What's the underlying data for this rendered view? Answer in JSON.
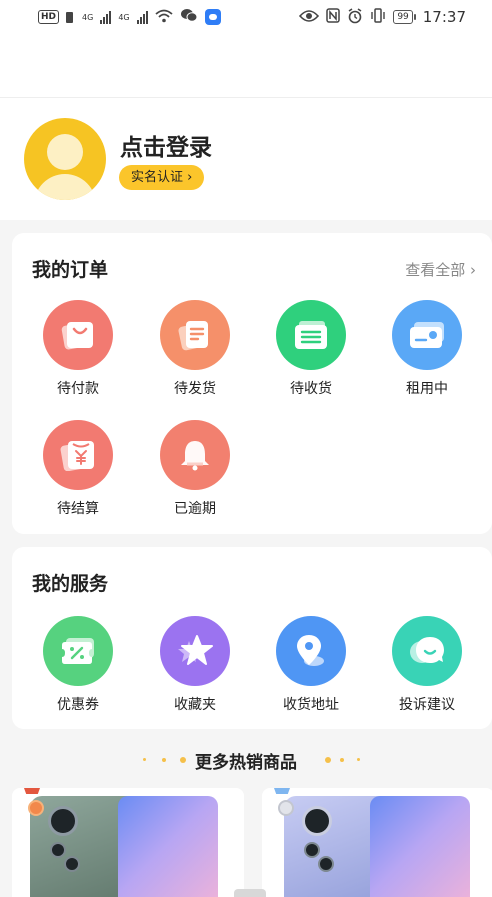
{
  "status_bar": {
    "left_labels": [
      "HD",
      "4G",
      "4G"
    ],
    "battery": "99",
    "time": "17:37"
  },
  "profile": {
    "login_text": "点击登录",
    "verify_label": "实名认证"
  },
  "orders": {
    "title": "我的订单",
    "view_all": "查看全部",
    "items": [
      {
        "label": "待付款",
        "icon": "bag-icon",
        "color": "#f27a71"
      },
      {
        "label": "待发货",
        "icon": "document-icon",
        "color": "#f5906a"
      },
      {
        "label": "待收货",
        "icon": "package-list-icon",
        "color": "#2fd07d"
      },
      {
        "label": "租用中",
        "icon": "card-icon",
        "color": "#5aa8f6"
      },
      {
        "label": "待结算",
        "icon": "yen-icon",
        "color": "#f27a71"
      },
      {
        "label": "已逾期",
        "icon": "bell-icon",
        "color": "#f2806f"
      }
    ]
  },
  "services": {
    "title": "我的服务",
    "items": [
      {
        "label": "优惠券",
        "icon": "coupon-icon",
        "color": "#56d27f"
      },
      {
        "label": "收藏夹",
        "icon": "star-icon",
        "color": "#9b73f0"
      },
      {
        "label": "收货地址",
        "icon": "location-pin-icon",
        "color": "#4f96f4"
      },
      {
        "label": "投诉建议",
        "icon": "chat-smile-icon",
        "color": "#39d3b6"
      }
    ]
  },
  "more": {
    "title": "更多热销商品"
  }
}
